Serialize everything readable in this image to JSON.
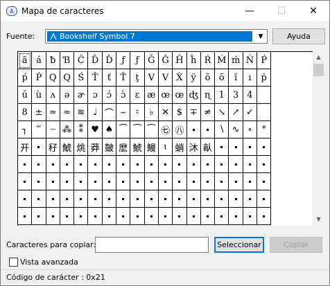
{
  "window": {
    "title": "Mapa de caracteres",
    "minimize": "—",
    "maximize": "☐",
    "close": "✕"
  },
  "font": {
    "label": "Fuente:",
    "selected": "Bookshelf Symbol 7",
    "help_button": "Ayuda"
  },
  "grid": {
    "rows": [
      [
        "ă",
        "á",
        "ƀ",
        "Ɓ",
        "Ĉ",
        "Ď",
        "Ď",
        "ƒ",
        "ƒ",
        "Ğ",
        "Ĝ",
        "Ĥ",
        "ĥ",
        "Ŕ",
        "Ḿ",
        "ḿ",
        "Ṅ",
        "Ṕ"
      ],
      [
        "ṕ",
        "Ṗ",
        "Q",
        "Q",
        "Ś",
        "Ť",
        "ť",
        "Ť",
        "ţ",
        "V",
        "V",
        "Ẋ",
        "ÿ",
        "ŏ",
        "ō",
        "ĭ",
        "ı",
        "ṗ"
      ],
      [
        "ú",
        "ù",
        "ʌ",
        "ə",
        "ɚ",
        "ɔ",
        "ɔ́",
        "ɔ̀",
        "ɛ",
        "æ",
        "œ",
        "œ",
        "ʤ",
        "ɳ",
        "1",
        "3",
        "4"
      ],
      [
        "8",
        "±",
        "≃",
        "≈",
        "≋",
        "♩",
        "⌒",
        "⌣",
        "♮",
        "♭",
        "✕",
        "$",
        "∓",
        "≠",
        "↘",
        "↗",
        "✓"
      ],
      [
        "┐",
        "‴",
        "┈",
        "⁂",
        "⁑",
        "♥",
        "♠",
        "⁀",
        "⁀",
        "⁀",
        "㊆",
        "㊇",
        "•",
        "•",
        "∖",
        "∿",
        "∘",
        "°"
      ],
      [
        "开",
        "•",
        "秄",
        "鯱",
        "烑",
        "莽",
        "皷",
        "麽",
        "鯱",
        "鰻",
        "ɩ",
        "蛸",
        "沐",
        "畒",
        "•",
        "•",
        "•",
        "•"
      ],
      [
        "•",
        "•",
        "•",
        "•",
        "•",
        "•",
        "•",
        "•",
        "•",
        "•",
        "•",
        "•",
        "•",
        "•",
        "•",
        "•",
        "•",
        "•"
      ],
      [
        "•",
        "•",
        "•",
        "•",
        "•",
        "•",
        "•",
        "•",
        "•",
        "•",
        "•",
        "•",
        "•",
        "•",
        "•",
        "•",
        "•",
        "•"
      ],
      [
        "•",
        "•",
        "•",
        "•",
        "•",
        "•",
        "•",
        "•",
        "•",
        "•",
        "•",
        "•",
        "•",
        "•",
        "•",
        "•",
        "•",
        "•"
      ],
      [
        "•",
        "•",
        "•",
        "•",
        "•",
        "•",
        "•",
        "•",
        "•",
        "•",
        "•",
        "•",
        "•",
        "•",
        "•",
        "•",
        "•",
        "•"
      ]
    ]
  },
  "copy": {
    "label": "Caracteres para copiar:",
    "value": "",
    "select_button": "Seleccionar",
    "copy_button": "Copiar"
  },
  "advanced_view": {
    "label": "Vista avanzada",
    "checked": false
  },
  "status": {
    "text": "Código de carácter : 0x21"
  },
  "colors": {
    "selection": "#0078d7",
    "window_bg": "#f0f0f0"
  }
}
